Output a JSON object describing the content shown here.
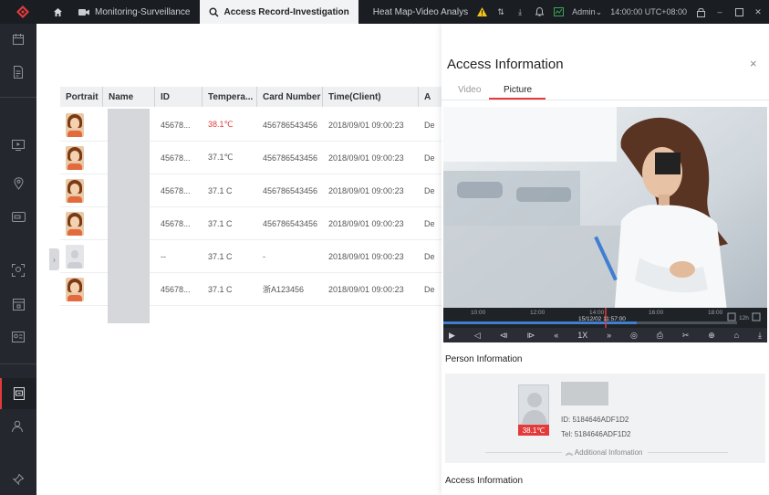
{
  "topbar": {
    "tabs": [
      {
        "label": "Monitoring-Surveillance",
        "icon": "camera-icon"
      },
      {
        "label": "Access Record-Investigation",
        "icon": "search-icon"
      },
      {
        "label": "Heat Map-Video Analys",
        "icon": "bar-chart-icon"
      }
    ],
    "user": "Admin",
    "time": "14:00:00 UTC+08:00"
  },
  "colors": {
    "accent": "#e33b3b",
    "topbar": "#1a1d22",
    "sidebar": "#24282e",
    "warning": "#f1c21b",
    "online": "#3aa655"
  },
  "table": {
    "columns": [
      "Portrait",
      "Name",
      "ID",
      "Tempera...",
      "Card Number",
      "Time(Client)",
      "A"
    ],
    "rows": [
      {
        "id": "45678...",
        "temp": "38.1℃",
        "hot": true,
        "card": "456786543456",
        "time": "2018/09/01 09:00:23",
        "extra": "De",
        "photo": true
      },
      {
        "id": "45678...",
        "temp": "37.1℃",
        "hot": false,
        "card": "456786543456",
        "time": "2018/09/01 09:00:23",
        "extra": "De",
        "photo": true
      },
      {
        "id": "45678...",
        "temp": "37.1 C",
        "hot": false,
        "card": "456786543456",
        "time": "2018/09/01 09:00:23",
        "extra": "De",
        "photo": true
      },
      {
        "id": "45678...",
        "temp": "37.1 C",
        "hot": false,
        "card": "456786543456",
        "time": "2018/09/01 09:00:23",
        "extra": "De",
        "photo": true
      },
      {
        "id": "--",
        "temp": "37.1 C",
        "hot": false,
        "card": "-",
        "time": "2018/09/01 09:00:23",
        "extra": "De",
        "photo": false
      },
      {
        "id": "45678...",
        "temp": "37.1 C",
        "hot": false,
        "card": "浙A123456",
        "time": "2018/09/01 09:00:23",
        "extra": "De",
        "photo": true
      }
    ]
  },
  "panel": {
    "title": "Access Information",
    "close": "×",
    "tabs": [
      "Video",
      "Picture"
    ],
    "timeline": {
      "ticks": [
        "10:00",
        "12:00",
        "14:00",
        "16:00",
        "18:00"
      ],
      "cursor": "15/12/02 11:57:00",
      "span": "12h"
    },
    "speed": "1X",
    "person_section": "Person Information",
    "person": {
      "id_label": "ID:",
      "id": "5184646ADF1D2",
      "tel_label": "Tel:",
      "tel": "5184646ADF1D2",
      "temp": "38.1℃",
      "more": "Additional Infomation"
    },
    "access_section": "Access Information"
  }
}
